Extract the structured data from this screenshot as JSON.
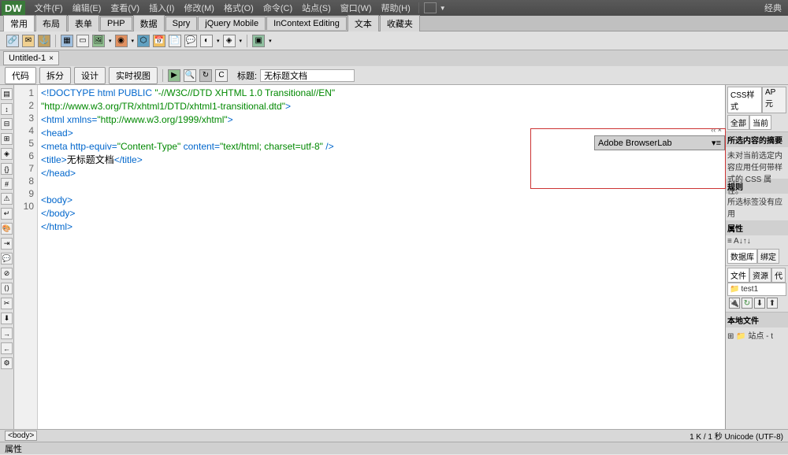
{
  "menubar": {
    "items": [
      "文件(F)",
      "编辑(E)",
      "查看(V)",
      "插入(I)",
      "修改(M)",
      "格式(O)",
      "命令(C)",
      "站点(S)",
      "窗口(W)",
      "帮助(H)"
    ],
    "layout_label": "经典"
  },
  "category_tabs": [
    "常用",
    "布局",
    "表单",
    "PHP",
    "数据",
    "Spry",
    "jQuery Mobile",
    "InContext Editing",
    "文本",
    "收藏夹"
  ],
  "doc_tab": {
    "name": "Untitled-1",
    "close": "×"
  },
  "view_bar": {
    "buttons": [
      "代码",
      "拆分",
      "设计",
      "实时视图"
    ],
    "title_label": "标题:",
    "title_value": "无标题文档"
  },
  "code": {
    "lines": [
      1,
      2,
      3,
      4,
      5,
      6,
      7,
      8,
      9,
      10
    ],
    "l1a": "<!DOCTYPE html PUBLIC ",
    "l1b": "\"-//W3C//DTD XHTML 1.0 Transitional//EN\"",
    "l1c": "\"http://www.w3.org/TR/xhtml1/DTD/xhtml1-transitional.dtd\"",
    "l1d": ">",
    "l2a": "<html xmlns=",
    "l2b": "\"http://www.w3.org/1999/xhtml\"",
    "l2c": ">",
    "l3": "<head>",
    "l4a": "<meta http-equiv=",
    "l4b": "\"Content-Type\"",
    "l4c": " content=",
    "l4d": "\"text/html; charset=utf-8\"",
    "l4e": " />",
    "l5a": "<title>",
    "l5b": "无标题文档",
    "l5c": "</title>",
    "l6": "</head>",
    "l7": "",
    "l8": "<body>",
    "l9": "</body>",
    "l10": "</html>"
  },
  "floating_panel": {
    "title": "Adobe BrowserLab",
    "menu": "▾≡",
    "winctrl": "‹‹ ×"
  },
  "right": {
    "css_tabs": [
      "CSS样式",
      "AP 元"
    ],
    "filter_tabs": [
      "全部",
      "当前"
    ],
    "summary_title": "所选内容的摘要",
    "summary_body": "未对当前选定内容应用任何带样式的 CSS 属性。",
    "rules_title": "规则",
    "rules_body": "所选标签没有应用",
    "props_title": "属性",
    "props_toolbar": "≡ A↓↑↓",
    "db_tabs": [
      "数据库",
      "绑定"
    ],
    "files_tabs": [
      "文件",
      "资源",
      "代"
    ],
    "site_name": "test1",
    "local_files_title": "本地文件",
    "site_item": "站点 - t"
  },
  "statusbar": {
    "tag": "<body>",
    "info": "1 K / 1 秒 Unicode (UTF-8)"
  },
  "bottom_bar": {
    "label": "属性"
  }
}
